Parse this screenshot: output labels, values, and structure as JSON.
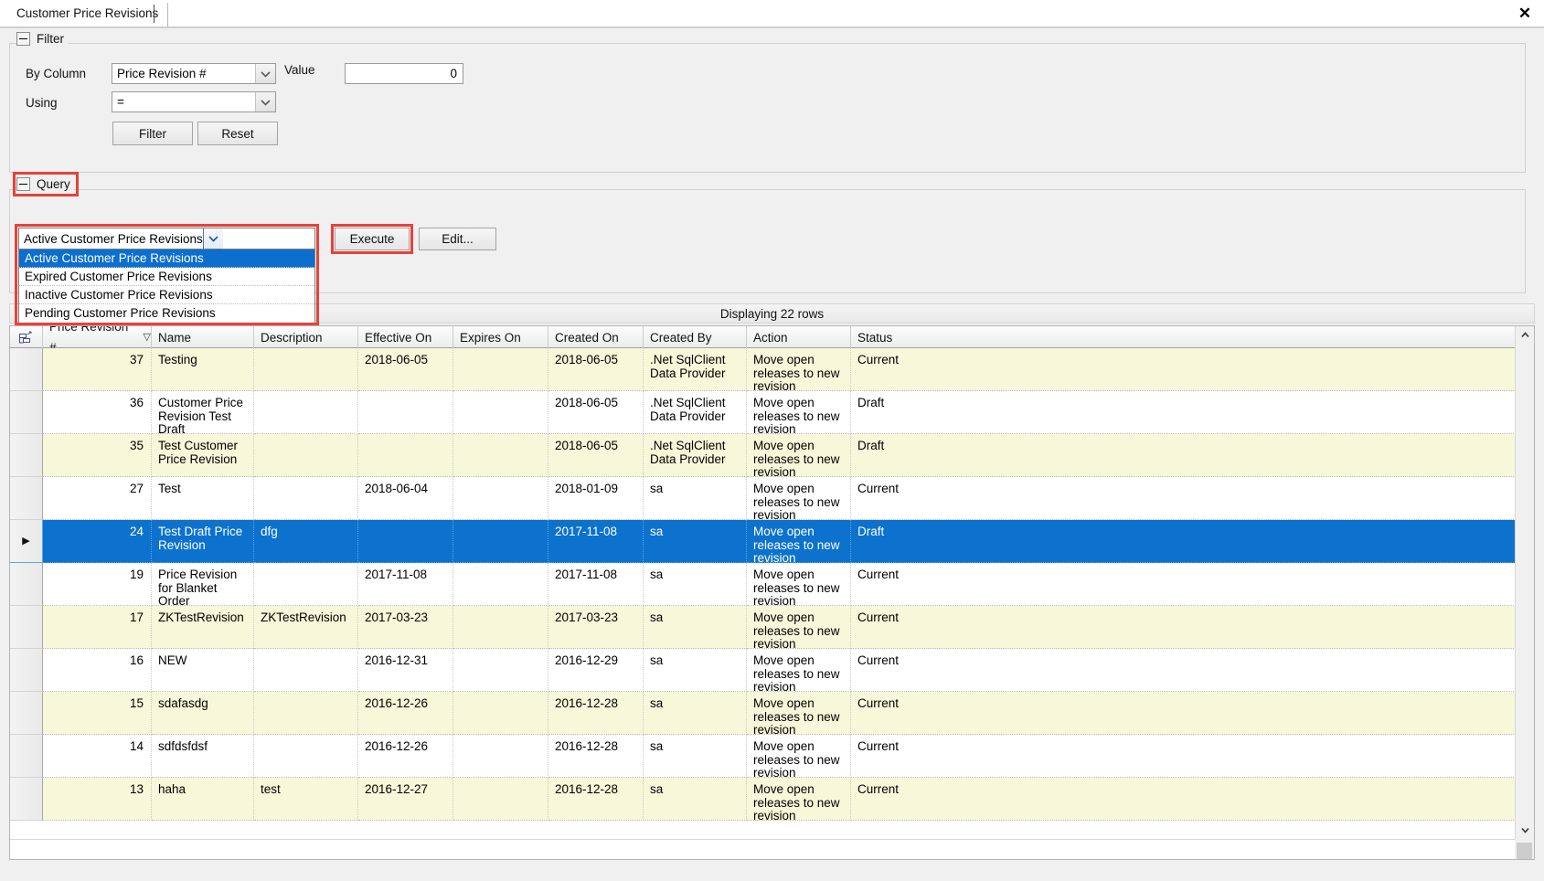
{
  "window": {
    "tab_title": "Customer Price Revisions",
    "close_icon": "close-icon"
  },
  "filter": {
    "legend": "Filter",
    "by_column_label": "By Column",
    "by_column_value": "Price Revision #",
    "using_label": "Using",
    "using_value": "=",
    "value_label": "Value",
    "value_text": "0",
    "filter_button": "Filter",
    "reset_button": "Reset"
  },
  "query": {
    "legend": "Query",
    "selected": "Active Customer Price Revisions",
    "options": [
      "Active Customer Price Revisions",
      "Expired Customer Price Revisions",
      "Inactive Customer Price Revisions",
      "Pending Customer Price Revisions"
    ],
    "selected_index": 0,
    "execute_button": "Execute",
    "edit_button": "Edit..."
  },
  "results": {
    "status_text": "Displaying 22 rows",
    "columns": [
      "Price Revision #",
      "Name",
      "Description",
      "Effective On",
      "Expires On",
      "Created On",
      "Created By",
      "Action",
      "Status"
    ],
    "sort_column": "Price Revision #",
    "sort_glyph": "▽",
    "rows": [
      {
        "price_revision": "37",
        "name": "Testing",
        "description": "",
        "effective_on": "2018-06-05",
        "expires_on": "",
        "created_on": "2018-06-05",
        "created_by": ".Net SqlClient Data Provider",
        "action": "Move open releases to new revision",
        "status": "Current"
      },
      {
        "price_revision": "36",
        "name": "Customer Price Revision Test Draft",
        "description": "",
        "effective_on": "",
        "expires_on": "",
        "created_on": "2018-06-05",
        "created_by": ".Net SqlClient Data Provider",
        "action": "Move open releases to new revision",
        "status": "Draft"
      },
      {
        "price_revision": "35",
        "name": "Test Customer Price Revision",
        "description": "",
        "effective_on": "",
        "expires_on": "",
        "created_on": "2018-06-05",
        "created_by": ".Net SqlClient Data Provider",
        "action": "Move open releases to new revision",
        "status": "Draft"
      },
      {
        "price_revision": "27",
        "name": "Test",
        "description": "",
        "effective_on": "2018-06-04",
        "expires_on": "",
        "created_on": "2018-01-09",
        "created_by": "sa",
        "action": "Move open releases to new revision",
        "status": "Current"
      },
      {
        "price_revision": "24",
        "name": "Test Draft Price Revision",
        "description": "dfg",
        "effective_on": "",
        "expires_on": "",
        "created_on": "2017-11-08",
        "created_by": "sa",
        "action": "Move open releases to new revision",
        "status": "Draft"
      },
      {
        "price_revision": "19",
        "name": "Price Revision for Blanket Order",
        "description": "",
        "effective_on": "2017-11-08",
        "expires_on": "",
        "created_on": "2017-11-08",
        "created_by": "sa",
        "action": "Move open releases to new revision",
        "status": "Current"
      },
      {
        "price_revision": "17",
        "name": "ZKTestRevision",
        "description": "ZKTestRevision",
        "effective_on": "2017-03-23",
        "expires_on": "",
        "created_on": "2017-03-23",
        "created_by": "sa",
        "action": "Move open releases to new revision",
        "status": "Current"
      },
      {
        "price_revision": "16",
        "name": "NEW",
        "description": "",
        "effective_on": "2016-12-31",
        "expires_on": "",
        "created_on": "2016-12-29",
        "created_by": "sa",
        "action": "Move open releases to new revision",
        "status": "Current"
      },
      {
        "price_revision": "15",
        "name": "sdafasdg",
        "description": "",
        "effective_on": "2016-12-26",
        "expires_on": "",
        "created_on": "2016-12-28",
        "created_by": "sa",
        "action": "Move open releases to new revision",
        "status": "Current"
      },
      {
        "price_revision": "14",
        "name": "sdfdsfdsf",
        "description": "",
        "effective_on": "2016-12-26",
        "expires_on": "",
        "created_on": "2016-12-28",
        "created_by": "sa",
        "action": "Move open releases to new revision",
        "status": "Current"
      },
      {
        "price_revision": "13",
        "name": "haha",
        "description": "test",
        "effective_on": "2016-12-27",
        "expires_on": "",
        "created_on": "2016-12-28",
        "created_by": "sa",
        "action": "Move open releases to new revision",
        "status": "Current"
      }
    ],
    "selected_row_index": 4,
    "row_selector_glyph": "▶"
  },
  "scrollbars": {
    "up_arrow": "▲",
    "down_arrow": "▼"
  },
  "colors": {
    "selection_blue": "#0c72cd",
    "alt_row_yellow": "#f7f7d9",
    "highlight_red": "#e8413a",
    "panel_gray": "#f0f0f0"
  }
}
